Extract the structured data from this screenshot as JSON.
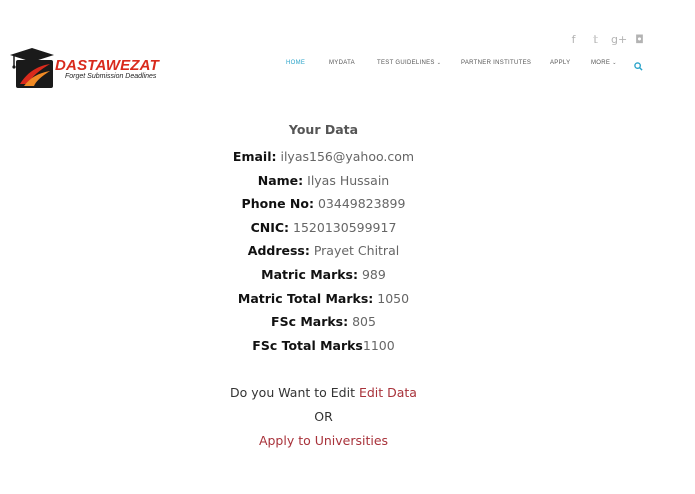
{
  "social": {
    "facebook": "f",
    "twitter": "𝕥",
    "google_plus": "g+",
    "instagram": "◘"
  },
  "brand": {
    "name": "DASTAWEZAT",
    "tagline": "Forget Submission Deadlines",
    "colors": {
      "red": "#d92a1c",
      "accent_nav": "#29a3c9",
      "link": "#a8323a"
    }
  },
  "nav": {
    "items": [
      {
        "label": "HOME",
        "active": true
      },
      {
        "label": "MYDATA"
      },
      {
        "label": "TEST GUIDELINES",
        "dropdown": true
      },
      {
        "label": "PARTNER INSTITUTES"
      },
      {
        "label": "APPLY"
      },
      {
        "label": "MORE",
        "dropdown": true
      }
    ]
  },
  "main": {
    "title": "Your Data",
    "fields": [
      {
        "label": "Email:",
        "value": " ilyas156@yahoo.com"
      },
      {
        "label": "Name:",
        "value": " Ilyas Hussain"
      },
      {
        "label": "Phone No:",
        "value": " 03449823899"
      },
      {
        "label": "CNIC:",
        "value": " 1520130599917"
      },
      {
        "label": "Address:",
        "value": " Prayet Chitral"
      },
      {
        "label": "Matric Marks:",
        "value": " 989"
      },
      {
        "label": "Matric Total Marks:",
        "value": " 1050"
      },
      {
        "label": "FSc Marks:",
        "value": " 805"
      },
      {
        "label": "FSc Total Marks",
        "value": "1100"
      }
    ],
    "edit_prompt": "Do you Want to Edit ",
    "edit_link": "Edit Data",
    "or_text": "OR",
    "apply_link": "Apply to Universities"
  }
}
